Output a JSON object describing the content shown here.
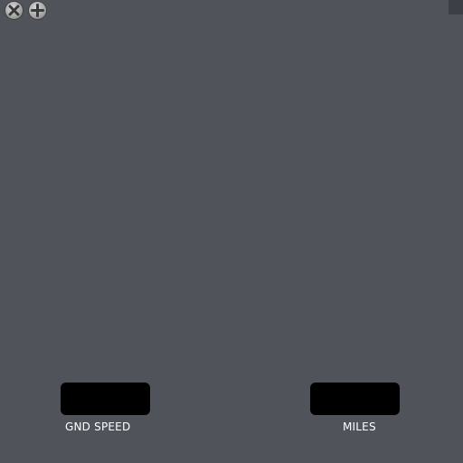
{
  "panel": {
    "icons": [
      "screw-head-icon",
      "screw-head-icon"
    ],
    "colors": {
      "background": "#50535a",
      "display": "#000000",
      "label": "#ffffff"
    }
  },
  "gauges": {
    "ground_speed": {
      "label": "GND SPEED",
      "value": ""
    },
    "miles": {
      "label": "MILES",
      "value": ""
    }
  }
}
